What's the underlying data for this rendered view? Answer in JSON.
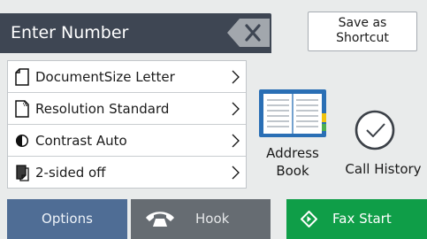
{
  "number_entry": {
    "placeholder": "Enter Number",
    "backspace_icon": "backspace-icon"
  },
  "shortcut_button": {
    "label": "Save as\nShortcut"
  },
  "settings": [
    {
      "label": "DocumentSize Letter",
      "icon": "document-size-icon"
    },
    {
      "label": "Resolution Standard",
      "icon": "resolution-icon"
    },
    {
      "label": "Contrast Auto",
      "icon": "contrast-icon"
    },
    {
      "label": "2-sided off",
      "icon": "two-sided-icon"
    }
  ],
  "quick_icons": {
    "address_book": {
      "label": "Address\nBook",
      "icon": "address-book-icon"
    },
    "call_history": {
      "label": "Call History",
      "icon": "clock-icon"
    }
  },
  "bottom_bar": {
    "options": {
      "label": "Options"
    },
    "hook": {
      "label": "Hook",
      "icon": "phone-handset-icon"
    },
    "fax_start": {
      "label": "Fax Start",
      "icon": "start-diamond-icon"
    }
  },
  "colors": {
    "number_bar": "#3e4653",
    "options": "#4f6d95",
    "hook": "#666c72",
    "fax_start": "#0f9e48",
    "accent_yellow": "#f1c40f",
    "accent_blue": "#2a6fb5"
  }
}
